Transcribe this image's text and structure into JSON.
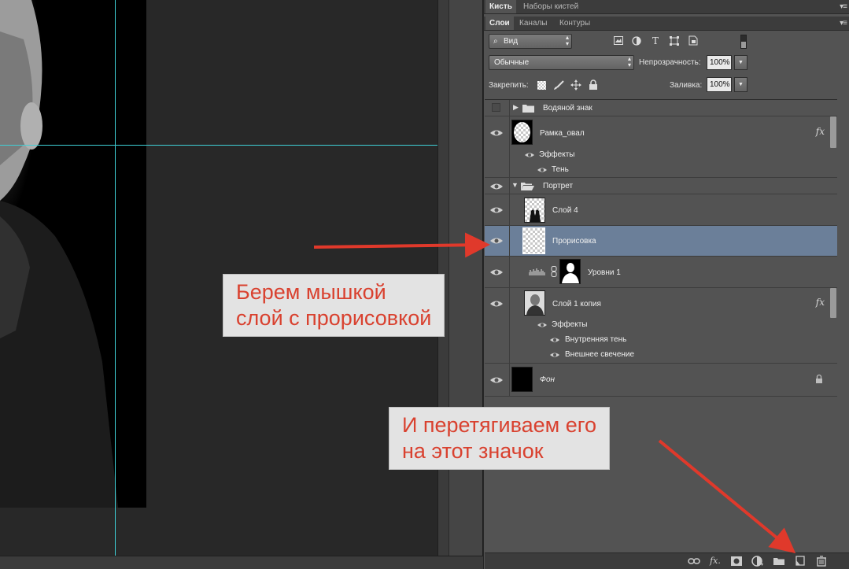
{
  "tabs_top": [
    "Кисть",
    "Наборы кистей"
  ],
  "tabs_layers": [
    "Слои",
    "Каналы",
    "Контуры"
  ],
  "filter": {
    "label": "Вид"
  },
  "blend": {
    "mode": "Обычные",
    "opacity_label": "Непрозрачность:",
    "opacity_value": "100%"
  },
  "lock": {
    "label": "Закрепить:",
    "fill_label": "Заливка:",
    "fill_value": "100%"
  },
  "layers": {
    "watermark": "Водяной знак",
    "frame": "Рамка_овал",
    "frame_effects": "Эффекты",
    "frame_shadow": "Тень",
    "portrait_group": "Портрет",
    "layer4": "Слой 4",
    "sketch": "Прорисовка",
    "levels": "Уровни 1",
    "copy": "Слой 1 копия",
    "copy_effects": "Эффекты",
    "copy_inner": "Внутренняя тень",
    "copy_outer": "Внешнее свечение",
    "background": "Фон",
    "fx_label": "fx"
  },
  "notes": {
    "note1_line1": "Берем мышкой",
    "note1_line2": "слой с прорисовкой",
    "note2_line1": "И перетягиваем его",
    "note2_line2": "на этот значок"
  },
  "bottom_icons": [
    "link-icon",
    "fx-icon",
    "mask-icon",
    "adjustment-icon",
    "folder-icon",
    "new-layer-icon",
    "trash-icon"
  ],
  "bottom_fx": "fx.",
  "colors": {
    "selected_row": "#6b7f99",
    "note_text": "#d9412f",
    "guides": "#3fd0d6",
    "arrow": "#e0392b"
  }
}
